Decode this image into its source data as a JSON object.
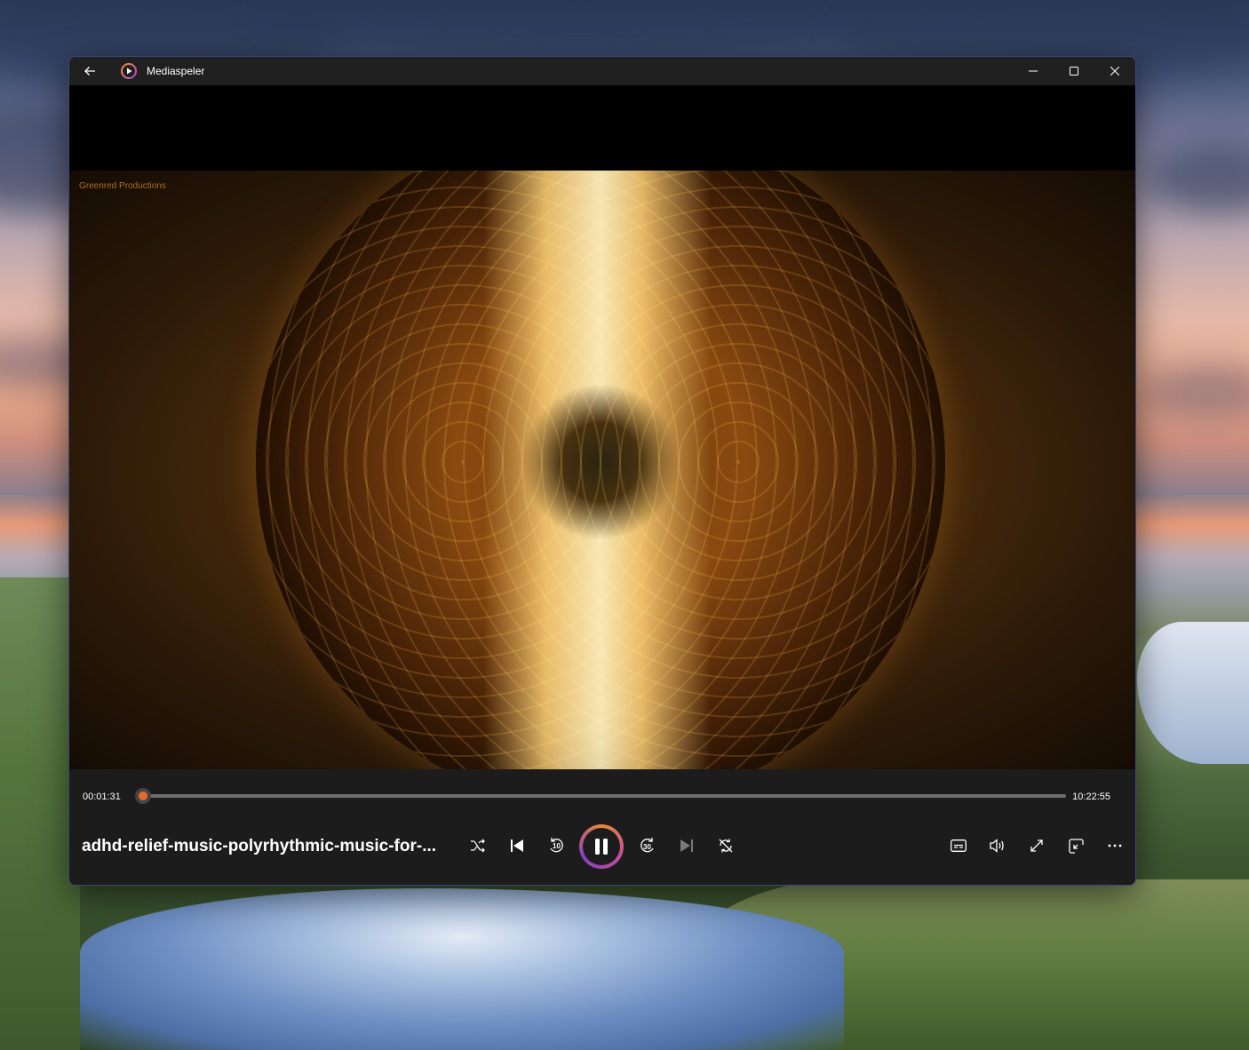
{
  "window": {
    "app_title": "Mediaspeler"
  },
  "video": {
    "watermark": "Greenred Productions"
  },
  "playback": {
    "current_time": "00:01:31",
    "total_time": "10:22:55",
    "progress_fraction": 0.0024,
    "track_title": "adhd-relief-music-polyrhythmic-music-for-...",
    "rewind_seconds": "10",
    "forward_seconds": "30",
    "state": "playing"
  },
  "colors": {
    "accent": "#e86a2a",
    "titlebar": "#202020",
    "controls_bg": "#1c1c1c"
  },
  "icons": {
    "back": "back-arrow-icon",
    "app": "media-player-icon",
    "shuffle": "shuffle-icon",
    "previous": "previous-track-icon",
    "rewind": "rewind-10-icon",
    "pause": "pause-icon",
    "forward": "forward-30-icon",
    "next": "next-track-icon",
    "repeat": "repeat-icon",
    "captions": "captions-icon",
    "volume": "volume-icon",
    "fullscreen": "fullscreen-icon",
    "miniplayer": "miniplayer-icon",
    "more": "more-options-icon"
  }
}
